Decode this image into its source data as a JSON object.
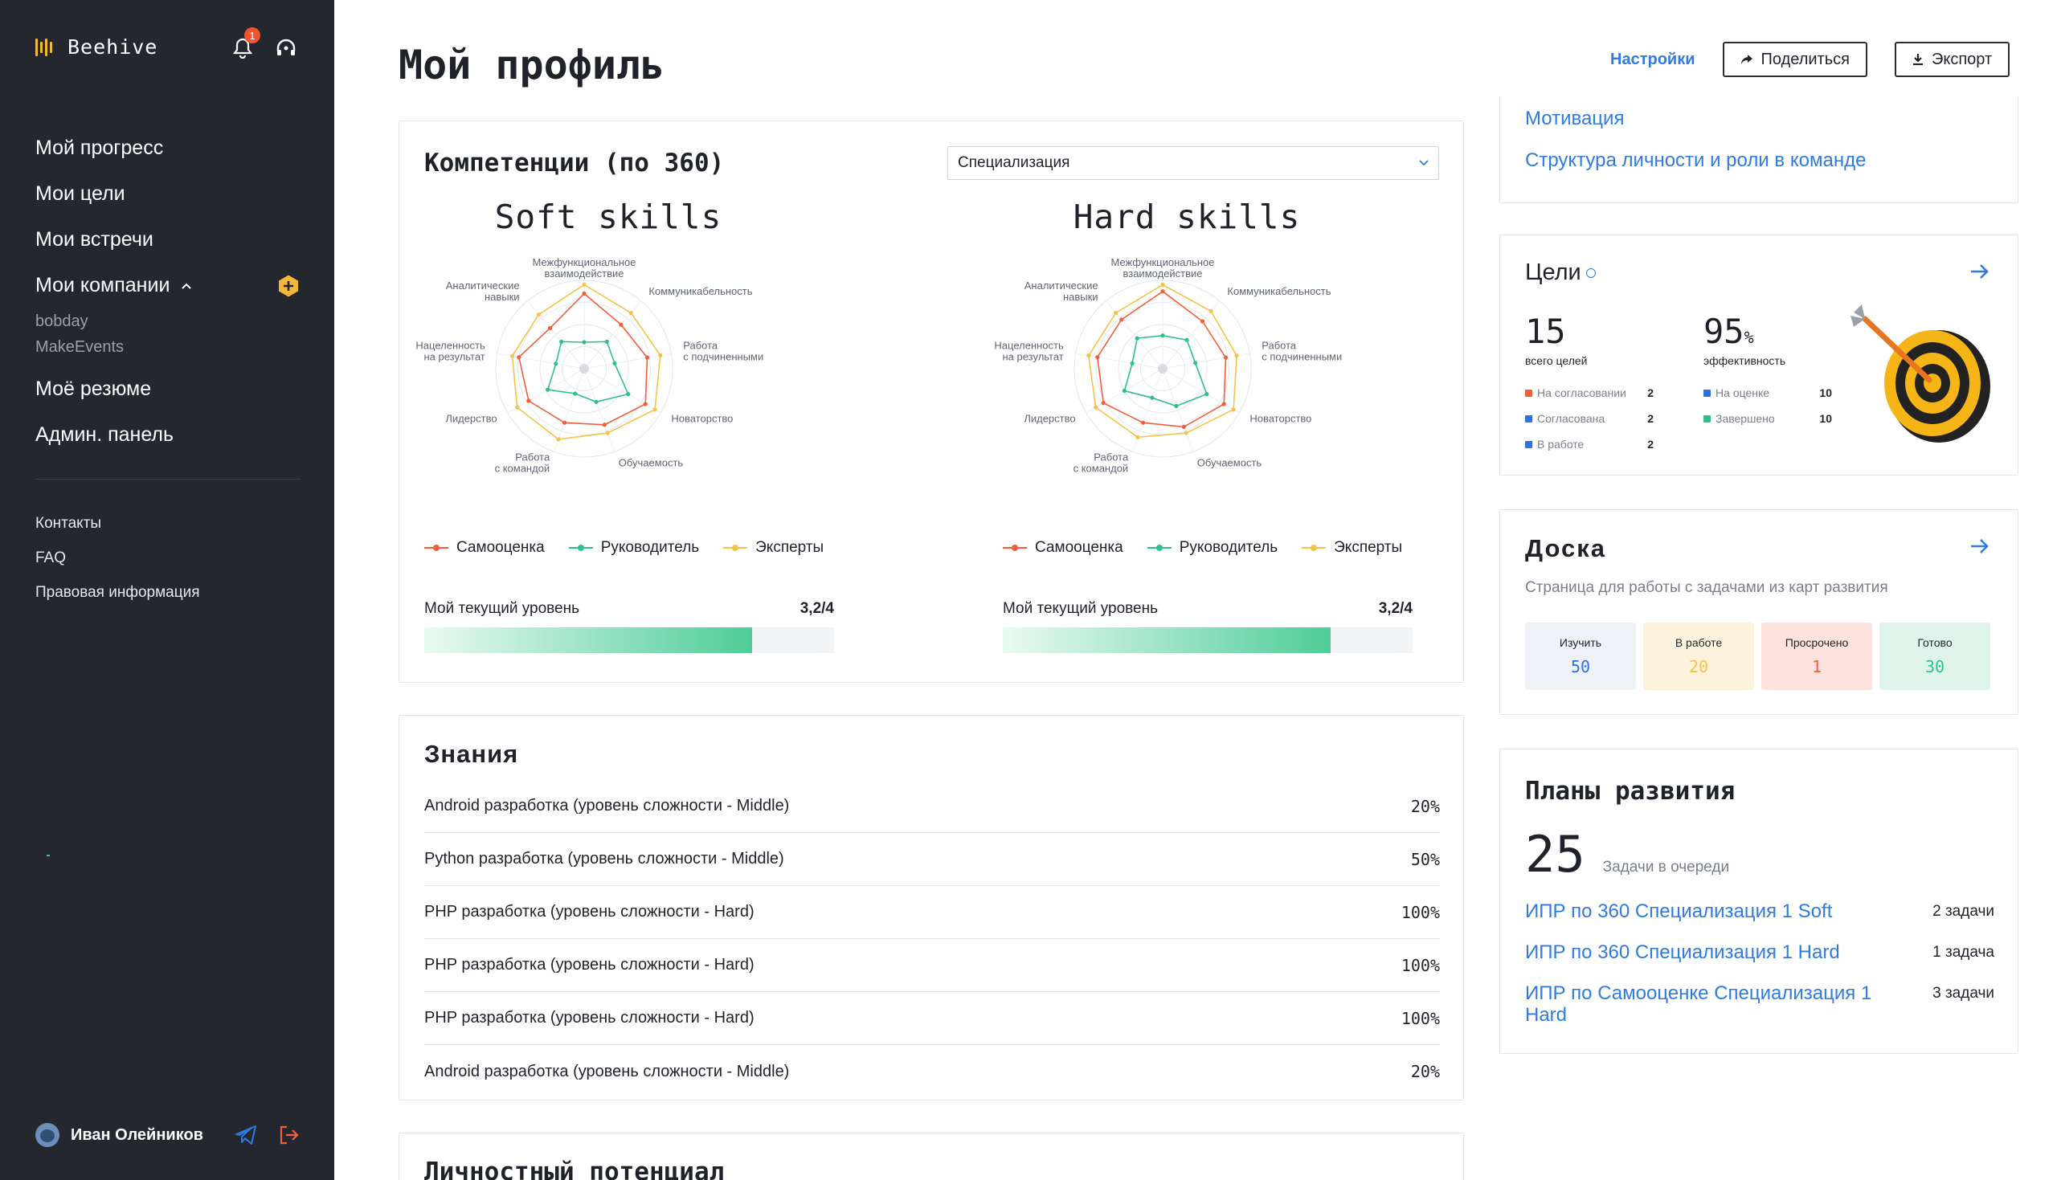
{
  "app": {
    "name": "Beehive",
    "notifications_count": "1"
  },
  "sidebar": {
    "nav": [
      {
        "label": "Мой прогресс"
      },
      {
        "label": "Мои цели"
      },
      {
        "label": "Мои встречи"
      },
      {
        "label": "Мои компании"
      },
      {
        "label": "Моё резюме"
      },
      {
        "label": "Админ. панель"
      }
    ],
    "companies": [
      "bobday",
      "MakeEvents"
    ],
    "secondary": [
      {
        "label": "Контакты"
      },
      {
        "label": "FAQ"
      },
      {
        "label": "Правовая информация"
      }
    ],
    "user": {
      "name": "Иван Олейников"
    }
  },
  "header": {
    "title": "Мой профиль",
    "settings_label": "Настройки",
    "share_label": "Поделиться",
    "export_label": "Экспорт"
  },
  "competencies": {
    "title": "Компетенции (по 360)",
    "select_value": "Специализация",
    "axes": [
      "Межфункциональное взаимодействие",
      "Коммуникабельность",
      "Работа с подчиненными",
      "Новаторство",
      "Обучаемость",
      "Работа с командой",
      "Лидерство",
      "Нацеленность на результат",
      "Аналитические навыки"
    ],
    "series_labels": [
      "Самооценка",
      "Руководитель",
      "Эксперты"
    ],
    "level_label": "Мой текущий уровень",
    "charts": [
      {
        "title": "Soft skills",
        "level_value": "3,2/4",
        "level_fraction": 0.8,
        "series": [
          {
            "name": "Самооценка",
            "values": [
              3.4,
              2.6,
              2.9,
              3.2,
              2.7,
              2.6,
              2.9,
              3.0,
              2.4
            ]
          },
          {
            "name": "Руководитель",
            "values": [
              1.2,
              1.6,
              1.4,
              2.3,
              1.6,
              1.2,
              1.9,
              1.3,
              1.6
            ]
          },
          {
            "name": "Эксперты",
            "values": [
              3.8,
              3.3,
              3.5,
              3.7,
              3.1,
              3.4,
              3.5,
              3.3,
              3.2
            ]
          }
        ]
      },
      {
        "title": "Hard skills",
        "level_value": "3,2/4",
        "level_fraction": 0.8,
        "series": [
          {
            "name": "Самооценка",
            "values": [
              3.5,
              2.8,
              2.9,
              3.2,
              2.8,
              2.6,
              3.1,
              3.0,
              2.9
            ]
          },
          {
            "name": "Руководитель",
            "values": [
              1.5,
              1.7,
              1.5,
              2.3,
              1.8,
              1.4,
              2.0,
              1.4,
              1.8
            ]
          },
          {
            "name": "Эксперты",
            "values": [
              3.8,
              3.4,
              3.4,
              3.7,
              3.1,
              3.3,
              3.5,
              3.4,
              3.3
            ]
          }
        ]
      }
    ],
    "colors": {
      "self": "#f0603d",
      "manager": "#2fbf8f",
      "experts": "#f4c34a"
    }
  },
  "knowledge": {
    "title": "Знания",
    "rows": [
      {
        "name": "Android разработка (уровень сложности - Middle)",
        "value": "20%"
      },
      {
        "name": "Python разработка (уровень сложности - Middle)",
        "value": "50%"
      },
      {
        "name": "PHP разработка (уровень сложности - Hard)",
        "value": "100%"
      },
      {
        "name": "PHP разработка (уровень сложности - Hard)",
        "value": "100%"
      },
      {
        "name": "PHP разработка (уровень сложности - Hard)",
        "value": "100%"
      },
      {
        "name": "Android разработка (уровень сложности - Middle)",
        "value": "20%"
      }
    ]
  },
  "potential": {
    "title": "Личностный потенциал"
  },
  "links": [
    "Мотивация",
    "Структура личности и роли в команде"
  ],
  "goals": {
    "title": "Цели",
    "total": "15",
    "total_label": "всего целей",
    "efficiency": "95",
    "efficiency_unit": "%",
    "efficiency_label": "эффективность",
    "left": [
      {
        "label": "На согласовании",
        "count": "2",
        "color": "#f0603d"
      },
      {
        "label": "Согласована",
        "count": "2",
        "color": "#2f6fe0"
      },
      {
        "label": "В работе",
        "count": "2",
        "color": "#2f6fe0"
      }
    ],
    "right": [
      {
        "label": "На оценке",
        "count": "10",
        "color": "#2f6fe0"
      },
      {
        "label": "Завершено",
        "count": "10",
        "color": "#2fbf8f"
      }
    ]
  },
  "board": {
    "title": "Доска",
    "subtitle": "Страница для работы с задачами из карт развития",
    "tiles": [
      {
        "label": "Изучить",
        "value": "50",
        "bg": "#eef2f7",
        "fg": "#2f6fe0"
      },
      {
        "label": "В работе",
        "value": "20",
        "bg": "#fdf3dc",
        "fg": "#f2c44c"
      },
      {
        "label": "Просрочено",
        "value": "1",
        "bg": "#fde2dd",
        "fg": "#f0603d"
      },
      {
        "label": "Готово",
        "value": "30",
        "bg": "#dff5ec",
        "fg": "#2fbf8f"
      }
    ]
  },
  "plans": {
    "title": "Планы развития",
    "queue_count": "25",
    "queue_label": "Задачи в очереди",
    "items": [
      {
        "name": "ИПР по 360 Специализация 1 Soft",
        "tasks": "2 задачи"
      },
      {
        "name": "ИПР по 360 Специализация 1 Hard",
        "tasks": "1 задача"
      },
      {
        "name": "ИПР по Самооценке Специализация 1 Hard",
        "tasks": "3 задачи"
      }
    ]
  }
}
